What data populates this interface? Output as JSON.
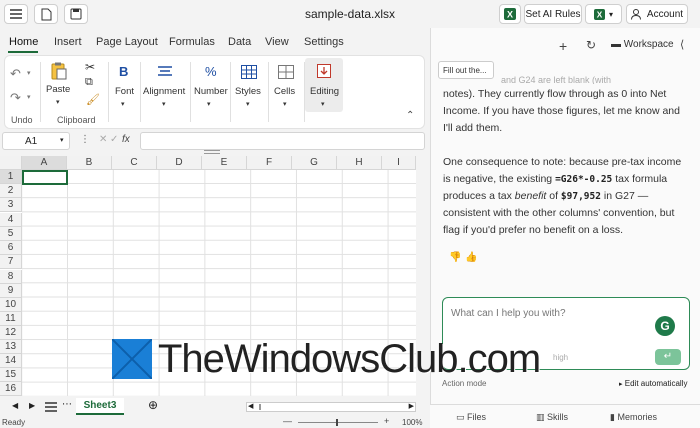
{
  "window": {
    "title": "sample-data.xlsx"
  },
  "topbar": {
    "set_ai_rules": "Set AI Rules",
    "account": "Account"
  },
  "tabs": [
    "Home",
    "Insert",
    "Page Layout",
    "Formulas",
    "Data",
    "View",
    "Settings"
  ],
  "ribbon": {
    "undo_label": "Undo",
    "clipboard_label": "Clipboard",
    "paste": "Paste",
    "font": "Font",
    "alignment": "Alignment",
    "number": "Number",
    "styles": "Styles",
    "cells": "Cells",
    "editing": "Editing",
    "font_icon_text": "B",
    "number_icon_text": "%"
  },
  "formula_bar": {
    "name_box": "A1",
    "fx": "fx",
    "value": ""
  },
  "grid": {
    "columns": [
      "A",
      "B",
      "C",
      "D",
      "E",
      "F",
      "G",
      "H",
      "I"
    ],
    "rows": [
      "1",
      "2",
      "3",
      "4",
      "5",
      "6",
      "7",
      "8",
      "9",
      "10",
      "11",
      "12",
      "13",
      "14",
      "15",
      "16"
    ],
    "selected_cell": "A1"
  },
  "sheets": {
    "active": "Sheet3"
  },
  "status": {
    "ready": "Ready",
    "zoom": "100%"
  },
  "pane": {
    "tooltip": "Fill out the...",
    "workspace": "Workspace",
    "msg1": "notes). They currently flow through as 0 into Net Income. If you have those figures, let me know and I'll add them.",
    "msg1_top": "and G24 are left blank (with",
    "msg2_a": "One consequence to note: because pre-tax income is negative, the existing ",
    "msg2_code1": "=G26*-0.25",
    "msg2_b": " tax formula produces a tax ",
    "msg2_em": "benefit",
    "msg2_c": " of ",
    "msg2_code2": "$97,952",
    "msg2_d": " in G27 — consistent with the other columns' convention, but flag if you'd prefer no benefit on a loss.",
    "input_placeholder": "What can I help you with?",
    "model_hint": "high",
    "action_mode": "Action mode",
    "edit_auto": "Edit automatically",
    "bottom_tabs": [
      "Files",
      "Skills",
      "Memories"
    ]
  },
  "watermark": "TheWindowsClub.com",
  "colors": {
    "accent": "#1d6b3a",
    "chat_border": "#2e8b57",
    "send": "#7cc49a"
  }
}
